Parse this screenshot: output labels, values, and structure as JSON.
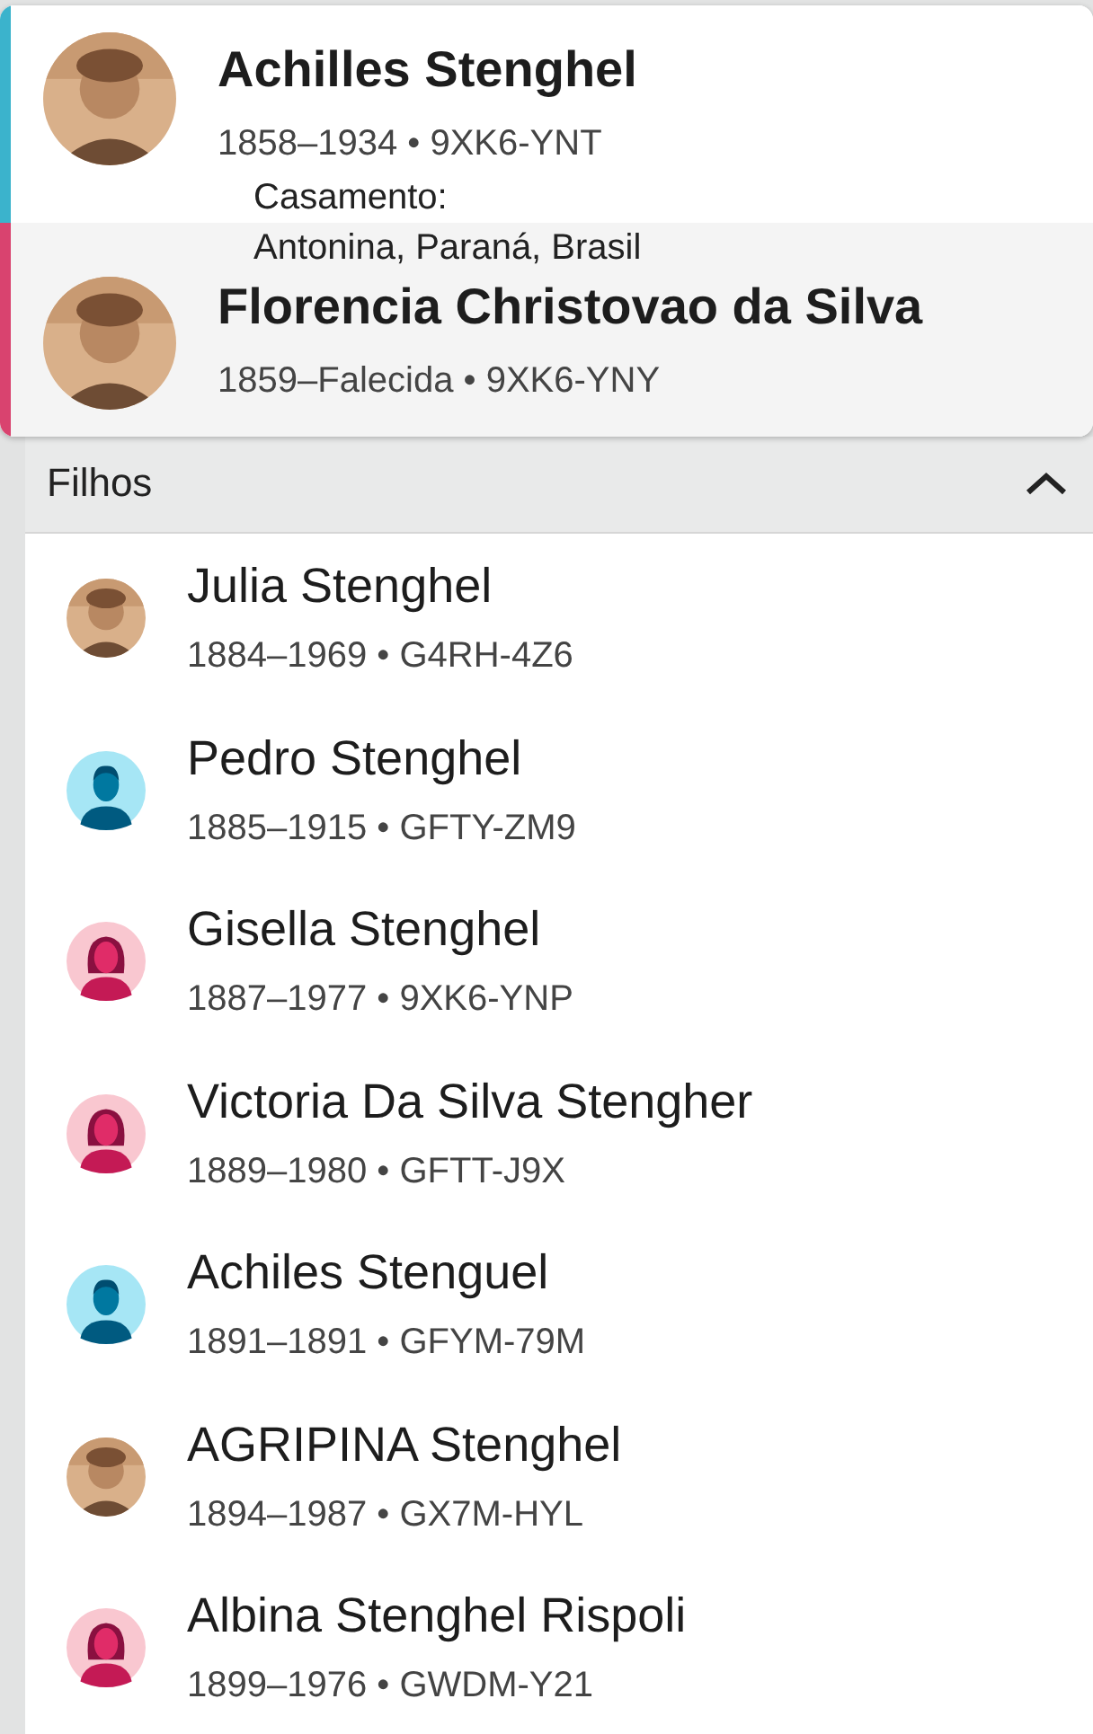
{
  "couple": {
    "spouses": [
      {
        "name": "Achilles Stenghel",
        "meta": "1858–1934 • 9XK6-YNT",
        "color": "#3bb3cc"
      },
      {
        "name": "Florencia Christovao da Silva",
        "meta": "1859–Falecida • 9XK6-YNY",
        "color": "#d9436f"
      }
    ],
    "marriage": {
      "label": "Casamento:",
      "place": "Antonina, Paraná, Brasil"
    }
  },
  "children_section": {
    "title": "Filhos",
    "expanded": true,
    "children": [
      {
        "name": "Julia Stenghel",
        "meta": "1884–1969 • G4RH-4Z6"
      },
      {
        "name": "Pedro Stenghel",
        "meta": "1885–1915 • GFTY-ZM9",
        "avatar": {
          "kind": "male"
        }
      },
      {
        "name": "Gisella Stenghel",
        "meta": "1887–1977 • 9XK6-YNP",
        "avatar": {
          "kind": "female"
        }
      },
      {
        "name": "Victoria Da Silva Stengher",
        "meta": "1889–1980 • GFTT-J9X",
        "avatar": {
          "kind": "female"
        }
      },
      {
        "name": "Achiles Stenguel",
        "meta": "1891–1891 • GFYM-79M",
        "avatar": {
          "kind": "male"
        }
      },
      {
        "name": "AGRIPINA Stenghel",
        "meta": "1894–1987 • GX7M-HYL"
      },
      {
        "name": "Albina Stenghel Rispoli",
        "meta": "1899–1976 • GWDM-Y21",
        "avatar": {
          "kind": "female"
        }
      }
    ]
  }
}
